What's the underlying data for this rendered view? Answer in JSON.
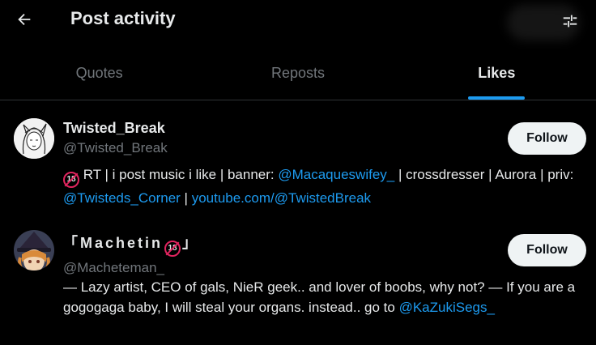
{
  "header": {
    "title": "Post activity",
    "back_icon": "arrow-left-icon",
    "filter_icon": "sliders-icon"
  },
  "tabs": [
    {
      "label": "Quotes",
      "active": false
    },
    {
      "label": "Reposts",
      "active": false
    },
    {
      "label": "Likes",
      "active": true
    }
  ],
  "users": [
    {
      "display_name": "Twisted_Break",
      "handle": "@Twisted_Break",
      "follow_label": "Follow",
      "bio": {
        "t1": " RT | i post music i like | banner: ",
        "link1": "@Macaqueswifey_",
        "t2": " | crossdresser | Aurora | priv: ",
        "link2": "@Twisteds_Corner",
        "t3": " | ",
        "link3": "youtube.com/@TwistedBreak"
      }
    },
    {
      "display_name_part1": "「Machetin",
      "display_name_part2": "」",
      "handle": "@Macheteman_",
      "follow_label": "Follow",
      "bio": {
        "t1": "— Lazy artist, CEO of gals, NieR geek.. and lover of boobs, why not? — If you are a gogogaga baby, I will steal your organs. instead.. go to ",
        "link1": "@KaZukiSegs_"
      }
    }
  ],
  "colors": {
    "background": "#000000",
    "text": "#e7e9ea",
    "muted": "#71767b",
    "accent": "#1d9bf0",
    "follow_bg": "#eff3f4",
    "badge": "#e0245e"
  },
  "badge_text": "18"
}
